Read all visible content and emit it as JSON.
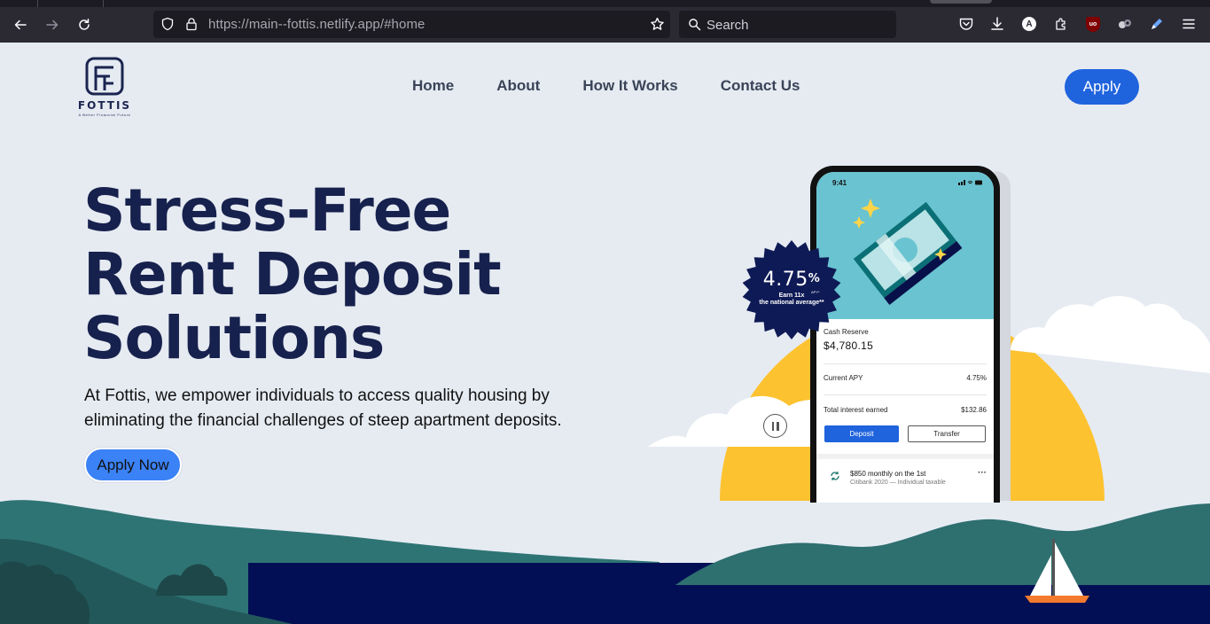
{
  "browser": {
    "url_host": "https://main--fottis.netlify.app",
    "url_path": "/#home",
    "search_placeholder": "Search",
    "icons": [
      "back-icon",
      "forward-icon",
      "reload-icon",
      "shield-icon",
      "lock-icon",
      "bookmark-star-icon",
      "search-icon",
      "pocket-icon",
      "download-icon",
      "account-icon",
      "extensions-icon",
      "ublock-icon",
      "extension-icon",
      "pen-icon",
      "menu-icon"
    ],
    "account_letter": "A",
    "ublock_label": "uo"
  },
  "site": {
    "logo": {
      "brand": "FOTTIS",
      "tagline": "A Better Financial Future"
    },
    "nav": [
      {
        "label": "Home"
      },
      {
        "label": "About"
      },
      {
        "label": "How It Works"
      },
      {
        "label": "Contact Us"
      }
    ],
    "apply_button": "Apply",
    "hero": {
      "title_lines": [
        "Stress-Free",
        "Rent Deposit",
        "Solutions"
      ],
      "description": "At Fottis, we empower individuals to access quality housing by eliminating the financial challenges of steep apartment deposits.",
      "cta": "Apply Now"
    },
    "badge": {
      "rate": "4.75",
      "pct": "%",
      "apy": "APY*",
      "line1": "Earn 11x",
      "line2": "the national average**"
    },
    "phone": {
      "time": "9:41",
      "cash_reserve_label": "Cash Reserve",
      "cash_reserve_value": "$4,780.15",
      "apy_label": "Current APY",
      "apy_value": "4.75%",
      "interest_label": "Total interest earned",
      "interest_value": "$132.86",
      "deposit_button": "Deposit",
      "transfer_button": "Transfer",
      "schedule_title": "$850 monthly on the 1st",
      "schedule_sub": "Citibank 2020 — Individual taxable",
      "more": "···"
    },
    "colors": {
      "navy": "#17214d",
      "accent_blue": "#1f63dd",
      "cta_blue": "#3b82f6",
      "sun": "#fdc230",
      "teal": "#2e6f70",
      "water": "#030f55",
      "bg": "#e6ebf2"
    }
  }
}
